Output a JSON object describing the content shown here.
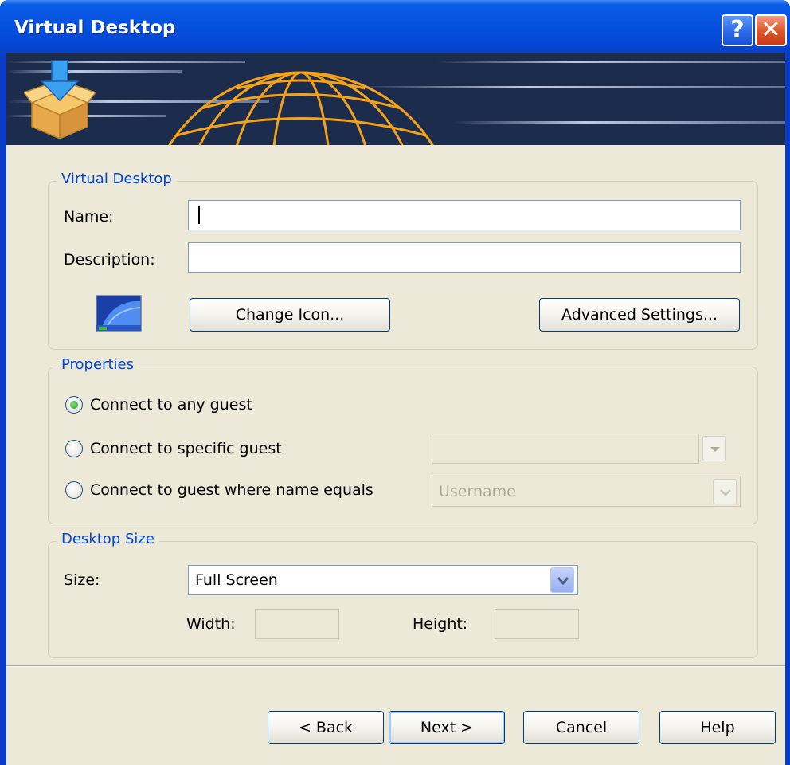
{
  "window": {
    "title": "Virtual Desktop",
    "help_glyph": "?",
    "close_glyph": "✕"
  },
  "banner": {
    "icon": "download-box-icon"
  },
  "virtual_desktop_group": {
    "title": "Virtual Desktop",
    "name_label": "Name:",
    "name_value": "",
    "description_label": "Description:",
    "description_value": "",
    "change_icon_button": "Change Icon...",
    "advanced_settings_button": "Advanced Settings..."
  },
  "properties_group": {
    "title": "Properties",
    "options": [
      {
        "label": "Connect to any guest",
        "selected": true
      },
      {
        "label": "Connect to specific guest",
        "selected": false
      },
      {
        "label": "Connect to guest where name equals",
        "selected": false
      }
    ],
    "specific_guest_value": "",
    "name_equals_value": "Username"
  },
  "desktop_size_group": {
    "title": "Desktop Size",
    "size_label": "Size:",
    "size_value": "Full Screen",
    "width_label": "Width:",
    "width_value": "",
    "height_label": "Height:",
    "height_value": ""
  },
  "footer": {
    "back_button": "< Back",
    "next_button": "Next >",
    "cancel_button": "Cancel",
    "help_button": "Help"
  },
  "colors": {
    "title_bar": "#0652e0",
    "group_title": "#0046d5",
    "dialog_background": "#ece9d8"
  }
}
